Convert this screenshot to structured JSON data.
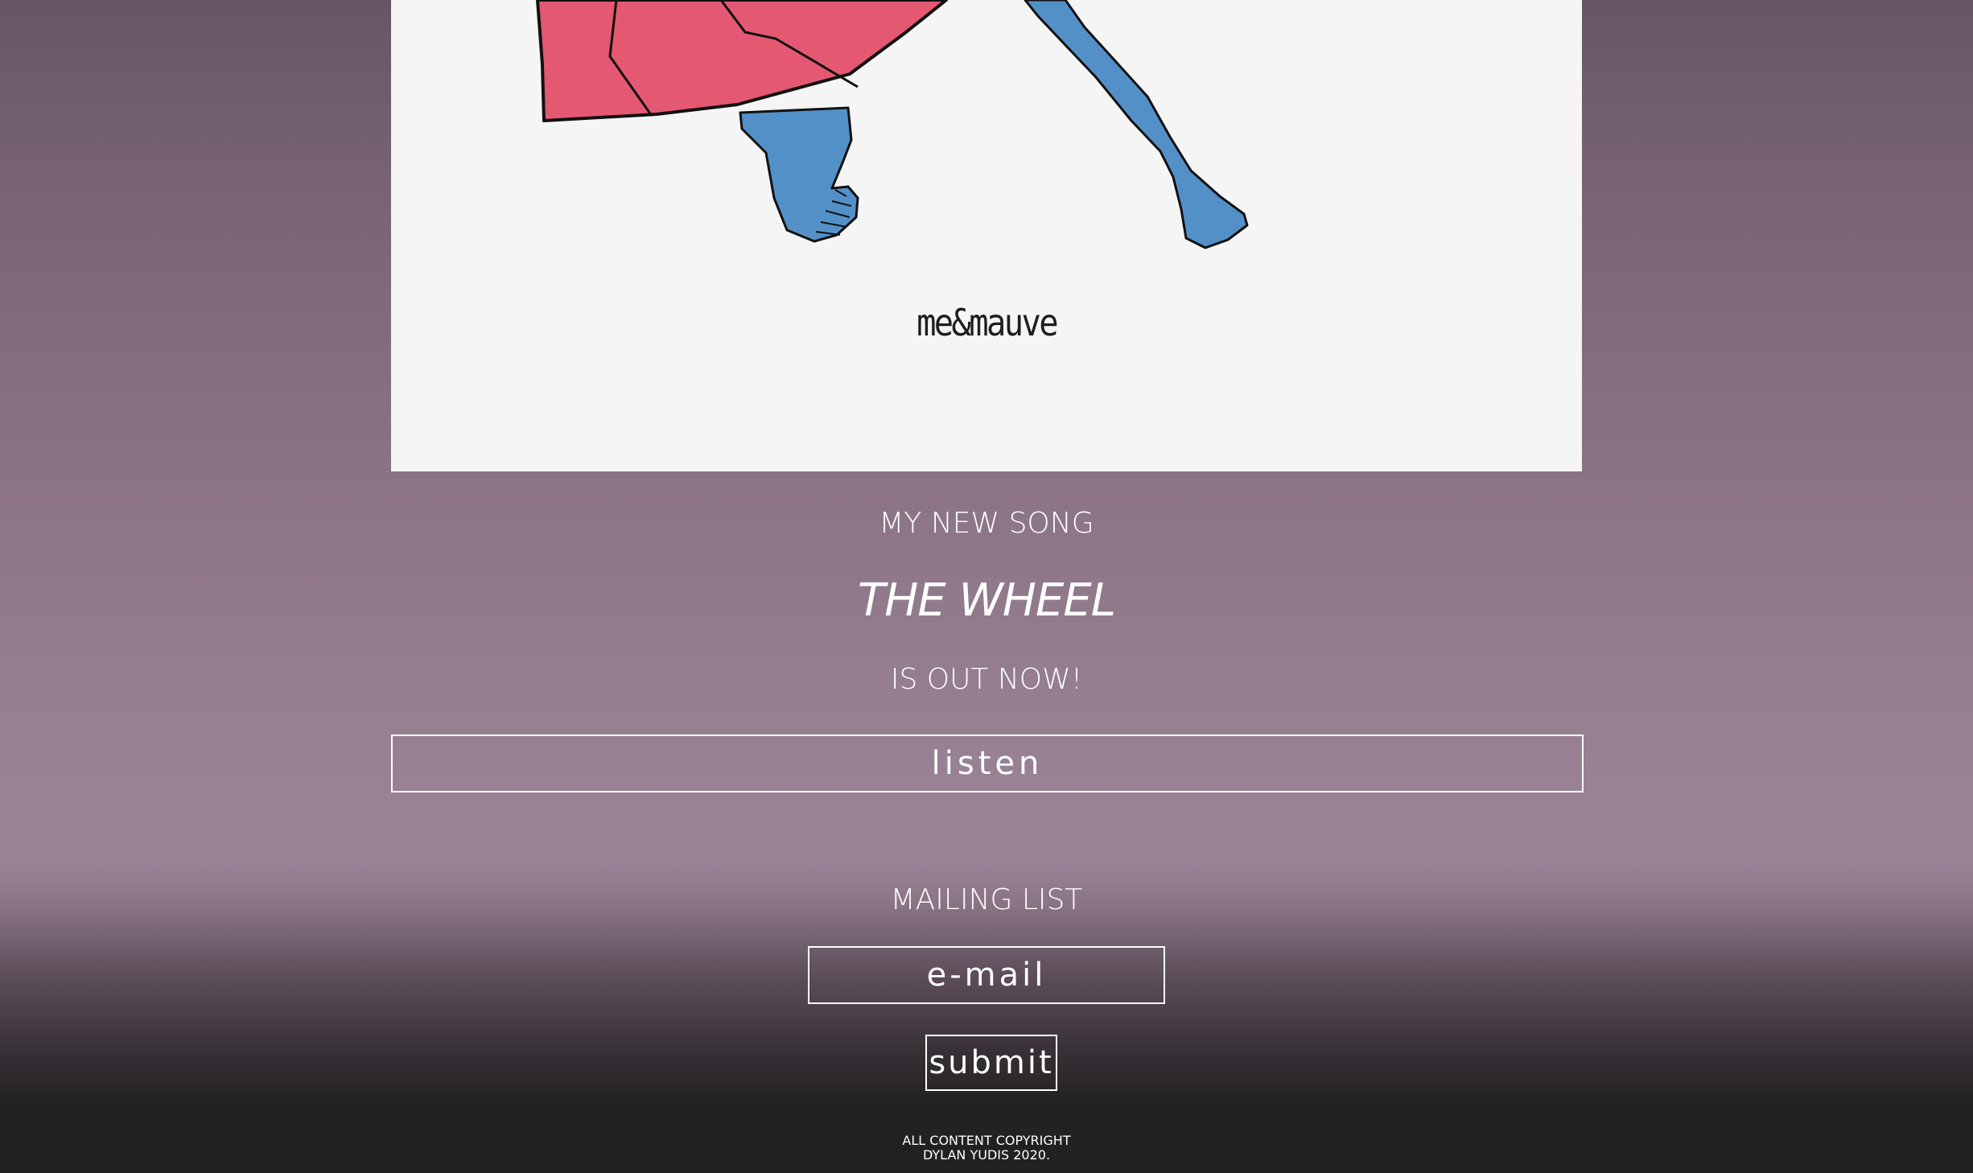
{
  "artwork": {
    "wordmark": "me&mauve",
    "colors": {
      "background": "#f5f5f5",
      "coat": "#e55872",
      "legs": "#5490c8",
      "outline": "#111111"
    }
  },
  "hero": {
    "line1": "MY NEW SONG",
    "song_title": "THE WHEEL",
    "line3": "IS OUT NOW!"
  },
  "listen": {
    "label": "listen"
  },
  "mailing": {
    "title": "MAILING LIST",
    "email_placeholder": "e-mail",
    "submit_label": "submit"
  },
  "footer": {
    "line1": "ALL CONTENT COPYRIGHT",
    "line2": "DYLAN YUDIS 2020."
  }
}
